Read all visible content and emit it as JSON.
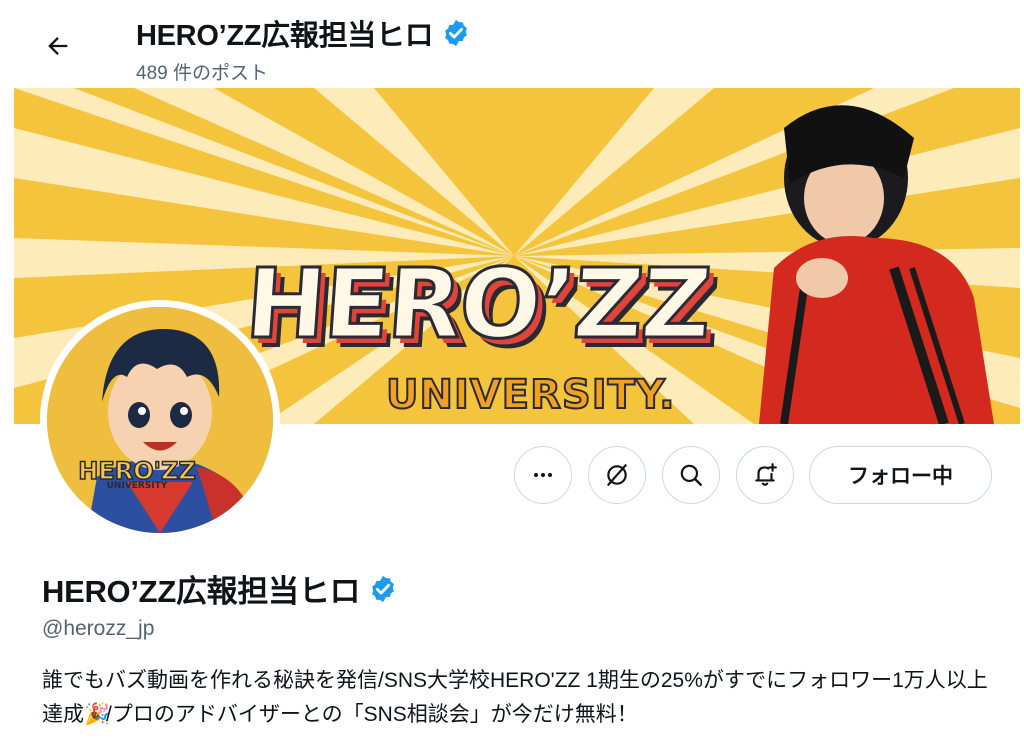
{
  "header": {
    "display_name": "HERO’ZZ広報担当ヒロ",
    "post_count": "489 件のポスト",
    "icons": {
      "back": "arrow-left-icon",
      "verified": "verified-badge-icon"
    }
  },
  "banner": {
    "title": "HERO’ZZ",
    "subtitle": "UNIVERSITY."
  },
  "avatar": {
    "logo_text": "HERO'ZZ",
    "logo_sub": "UNIVERSITY"
  },
  "actions": {
    "more_icon": "more-dots-icon",
    "grok_icon": "grok-icon",
    "search_icon": "search-icon",
    "notify_icon": "bell-plus-icon",
    "follow_label": "フォロー中"
  },
  "profile": {
    "display_name": "HERO’ZZ広報担当ヒロ",
    "handle": "@herozz_jp",
    "bio_part1": "誰でもバズ動画を作れる秘訣を発信/SNS大学校HERO'ZZ 1期生の25%がすでにフォロワー1万人以上達成",
    "bio_emoji": "🎉",
    "bio_part2": "/プロのアドバイザーとの「SNS相談会」が今だけ無料！"
  },
  "colors": {
    "verified": "#1d9bf0",
    "banner_bg": "#f4c43c",
    "text_secondary": "#536471",
    "border": "#cfd9de"
  }
}
